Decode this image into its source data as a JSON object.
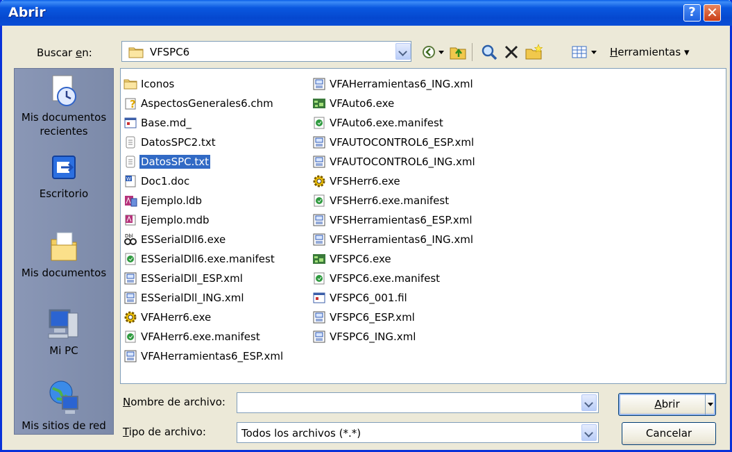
{
  "window": {
    "title": "Abrir",
    "help_icon": "help-icon",
    "close_icon": "close-icon"
  },
  "toolbar": {
    "lookin_label_prefix": "Buscar ",
    "lookin_label_key": "e",
    "lookin_label_suffix": "n:",
    "lookin_value": "VFSPC6",
    "tools_label_key": "H",
    "tools_label_rest": "erramientas"
  },
  "places": [
    {
      "label": "Mis documentos recientes",
      "icon": "recent-documents-icon"
    },
    {
      "label": "Escritorio",
      "icon": "desktop-icon"
    },
    {
      "label": "Mis documentos",
      "icon": "my-documents-icon"
    },
    {
      "label": "Mi PC",
      "icon": "my-computer-icon"
    },
    {
      "label": "Mis sitios de red",
      "icon": "network-places-icon"
    }
  ],
  "files_col1": [
    {
      "name": "Iconos",
      "icon": "folder"
    },
    {
      "name": "AspectosGenerales6.chm",
      "icon": "chm"
    },
    {
      "name": "Base.md_",
      "icon": "file"
    },
    {
      "name": "DatosSPC2.txt",
      "icon": "txt"
    },
    {
      "name": "DatosSPC.txt",
      "icon": "txt",
      "selected": true
    },
    {
      "name": "Doc1.doc",
      "icon": "doc"
    },
    {
      "name": "Ejemplo.ldb",
      "icon": "ldb"
    },
    {
      "name": "Ejemplo.mdb",
      "icon": "mdb"
    },
    {
      "name": "ESSerialDll6.exe",
      "icon": "dll"
    },
    {
      "name": "ESSerialDll6.exe.manifest",
      "icon": "manifest"
    },
    {
      "name": "ESSerialDll_ESP.xml",
      "icon": "xml"
    },
    {
      "name": "ESSerialDll_ING.xml",
      "icon": "xml"
    },
    {
      "name": "VFAHerr6.exe",
      "icon": "gear"
    },
    {
      "name": "VFAHerr6.exe.manifest",
      "icon": "manifest"
    },
    {
      "name": "VFAHerramientas6_ESP.xml",
      "icon": "xml"
    }
  ],
  "files_col2": [
    {
      "name": "VFAHerramientas6_ING.xml",
      "icon": "xml"
    },
    {
      "name": "VFAuto6.exe",
      "icon": "exe"
    },
    {
      "name": "VFAuto6.exe.manifest",
      "icon": "manifest"
    },
    {
      "name": "VFAUTOCONTROL6_ESP.xml",
      "icon": "xml"
    },
    {
      "name": "VFAUTOCONTROL6_ING.xml",
      "icon": "xml"
    },
    {
      "name": "VFSHerr6.exe",
      "icon": "gear"
    },
    {
      "name": "VFSHerr6.exe.manifest",
      "icon": "manifest"
    },
    {
      "name": "VFSHerramientas6_ESP.xml",
      "icon": "xml"
    },
    {
      "name": "VFSHerramientas6_ING.xml",
      "icon": "xml"
    },
    {
      "name": "VFSPC6.exe",
      "icon": "exe"
    },
    {
      "name": "VFSPC6.exe.manifest",
      "icon": "manifest"
    },
    {
      "name": "VFSPC6_001.fil",
      "icon": "file"
    },
    {
      "name": "VFSPC6_ESP.xml",
      "icon": "xml"
    },
    {
      "name": "VFSPC6_ING.xml",
      "icon": "xml"
    }
  ],
  "footer": {
    "filename_label_key": "N",
    "filename_label_rest": "ombre de archivo:",
    "filename_value": "",
    "filetype_label_key": "T",
    "filetype_label_rest": "ipo de archivo:",
    "filetype_value": "Todos los archivos (*.*)",
    "open_key": "A",
    "open_rest": "brir",
    "cancel_label": "Cancelar"
  },
  "colors": {
    "title_bar": "#0a58e0",
    "selection": "#316ac5",
    "places_bar": "#7e8ba9",
    "dialog_bg": "#ece9d8"
  }
}
